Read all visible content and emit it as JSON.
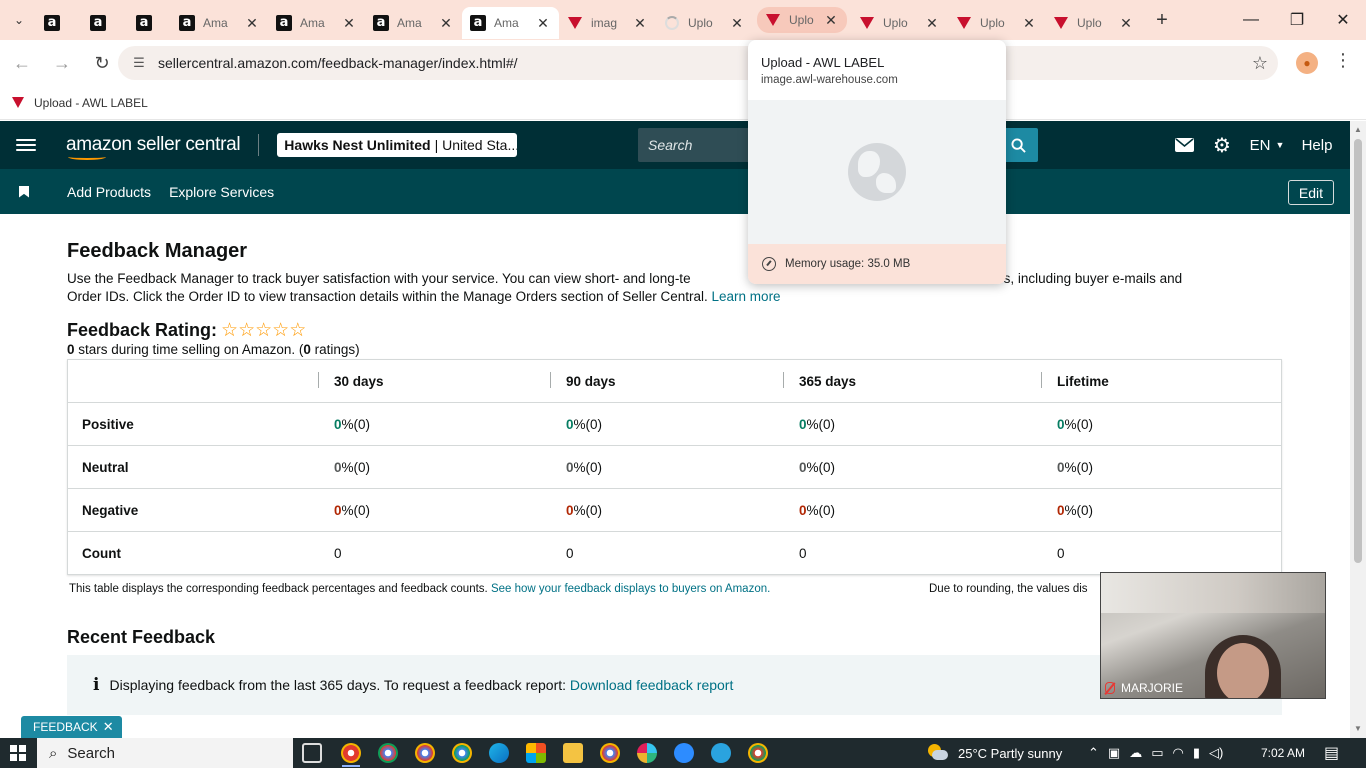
{
  "browser": {
    "tabs": [
      {
        "title": "",
        "favicon": "amazon-icon",
        "pinned": true
      },
      {
        "title": "",
        "favicon": "amazon-icon",
        "pinned": true
      },
      {
        "title": "",
        "favicon": "amazon-icon",
        "pinned": true
      },
      {
        "title": "Ama",
        "favicon": "amazon-icon"
      },
      {
        "title": "Ama",
        "favicon": "amazon-icon"
      },
      {
        "title": "Ama",
        "favicon": "amazon-icon"
      },
      {
        "title": "Ama",
        "favicon": "amazon-icon",
        "active": true
      },
      {
        "title": "imag",
        "favicon": "awl-icon"
      },
      {
        "title": "Uplo",
        "favicon": "loading-spinner-icon"
      },
      {
        "title": "Uplo",
        "favicon": "awl-icon",
        "hovered": true
      },
      {
        "title": "Uplo",
        "favicon": "awl-icon"
      },
      {
        "title": "Uplo",
        "favicon": "awl-icon"
      },
      {
        "title": "Uplo",
        "favicon": "awl-icon"
      }
    ],
    "url": "sellercentral.amazon.com/feedback-manager/index.html#/",
    "bookmark": {
      "label": "Upload - AWL LABEL"
    },
    "hover_card": {
      "title": "Upload - AWL LABEL",
      "domain": "image.awl-warehouse.com",
      "memory": "Memory usage: 35.0 MB"
    }
  },
  "header": {
    "logo": "amazon seller central",
    "store_name": "Hawks Nest Unlimited",
    "store_region": "| United Sta...",
    "search_placeholder": "Search",
    "language": "EN",
    "help": "Help",
    "subnav": [
      "Add Products",
      "Explore Services"
    ],
    "edit": "Edit"
  },
  "page": {
    "title": "Feedback Manager",
    "intro_text": "Use the Feedback Manager to track buyer satisfaction with your service. You can view short- and long-te",
    "intro_text_2": "ck entries, including buyer e-mails and",
    "intro_text_3": "Order IDs. Click the Order ID to view transaction details within the Manage Orders section of Seller Central.",
    "learn_more": "Learn more",
    "rating_label": "Feedback Rating:",
    "rating_stars": 0,
    "rating_max": 5,
    "stars_count": "0",
    "stars_note_mid": " stars during time selling on Amazon. (",
    "ratings_count": "0",
    "stars_note_end": " ratings)",
    "table": {
      "columns": [
        "",
        "30 days",
        "90 days",
        "365 days",
        "Lifetime"
      ],
      "rows": [
        {
          "label": "Positive",
          "values": [
            "0",
            "0",
            "0",
            "0"
          ],
          "counts": [
            " %(0)",
            " %(0)",
            " %(0)",
            " %(0)"
          ]
        },
        {
          "label": "Neutral",
          "values": [
            "0",
            "0",
            "0",
            "0"
          ],
          "counts": [
            " %(0)",
            " %(0)",
            " %(0)",
            " %(0)"
          ]
        },
        {
          "label": "Negative",
          "values": [
            "0",
            "0",
            "0",
            "0"
          ],
          "counts": [
            " %(0)",
            " %(0)",
            " %(0)",
            " %(0)"
          ]
        },
        {
          "label": "Count",
          "values": [
            "0",
            "0",
            "0",
            "0"
          ],
          "counts": [
            "",
            "",
            "",
            ""
          ]
        }
      ]
    },
    "table_note": "This table displays the corresponding feedback percentages and feedback counts.",
    "table_note_link": "See how your feedback displays to buyers on Amazon.",
    "rounding_note": "Due to rounding, the values dis",
    "recent_title": "Recent Feedback",
    "info_text": "Displaying feedback from the last 365 days. To request a feedback report:",
    "info_link": "Download feedback report",
    "feedback_tab": "FEEDBACK"
  },
  "video": {
    "name": "MARJORIE"
  },
  "taskbar": {
    "search": "Search",
    "weather": "25°C  Partly sunny",
    "time": "7:02 AM"
  },
  "colors": {
    "header_bg": "#002f36",
    "subnav_bg": "#00464e",
    "positive": "#067d62",
    "negative": "#b12704",
    "link": "#007185",
    "tab_strip": "#fbe2d9"
  }
}
